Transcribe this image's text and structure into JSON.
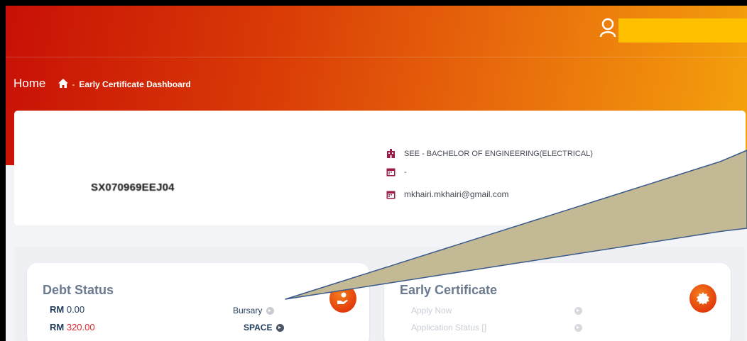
{
  "breadcrumb": {
    "home": "Home",
    "separator": "-",
    "page": "Early Certificate Dashboard"
  },
  "profile": {
    "student_id": "SX070969EEJ04",
    "program": "SEE - BACHELOR OF ENGINEERING(ELECTRICAL)",
    "date": "-",
    "email": "mkhairi.mkhairi@gmail.com"
  },
  "debt": {
    "title": "Debt Status",
    "currency": "RM",
    "amount_1": "0.00",
    "amount_2": "320.00",
    "bursary_label": "Bursary",
    "space_label": "SPACE"
  },
  "early": {
    "title": "Early Certificate",
    "apply_label": "Apply Now",
    "status_label": "Application Status []"
  },
  "colors": {
    "accent_orange": "#e2380a",
    "callout_fill": "#c4b995",
    "username_bar": "#ffc000",
    "icon_maroon": "#9b1b4a"
  }
}
